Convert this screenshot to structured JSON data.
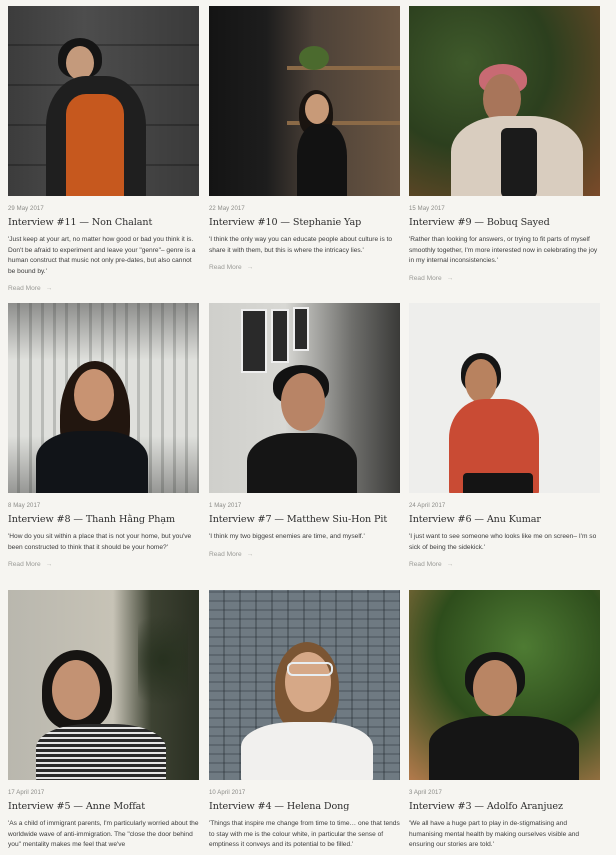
{
  "read_more_label": "Read More",
  "arrow": "→",
  "cards": [
    {
      "date": "29 May 2017",
      "title": "Interview #11 — Non Chalant",
      "excerpt": "'Just keep at your art, no matter how good or bad you think it is. Don't be afraid to experiment and leave your \"genre\"– genre is a human construct that music not only pre-dates, but also cannot be bound by.'"
    },
    {
      "date": "22 May 2017",
      "title": "Interview #10 — Stephanie Yap",
      "excerpt": "'I think the only way you can educate people about culture is to share it with them, but this is where the intricacy lies.'"
    },
    {
      "date": "15 May 2017",
      "title": "Interview #9 — Bobuq Sayed",
      "excerpt": "'Rather than looking for answers, or trying to fit parts of myself smoothly together, I'm more interested now in celebrating the joy in my internal inconsistencies.'"
    },
    {
      "date": "8 May 2017",
      "title": "Interview #8 — Thanh Hằng Phạm",
      "excerpt": "'How do you sit within a place that is not your home, but you've been constructed to think that it should be your home?'"
    },
    {
      "date": "1 May 2017",
      "title": "Interview #7 — Matthew Siu-Hon Pit",
      "excerpt": "'I think my two biggest enemies are time, and myself.'"
    },
    {
      "date": "24 April 2017",
      "title": "Interview #6 — Anu Kumar",
      "excerpt": "'I just want to see someone who looks like me on screen– I'm so sick of being the sidekick.'"
    },
    {
      "date": "17 April 2017",
      "title": "Interview #5 — Anne Moffat",
      "excerpt": "'As a child of immigrant parents, I'm particularly worried about the worldwide wave of anti-immigration. The \"close the door behind you\" mentality makes me feel that we've"
    },
    {
      "date": "10 April 2017",
      "title": "Interview #4 — Helena Dong",
      "excerpt": "'Things that inspire me change from time to time… one that tends to stay with me is the colour white, in particular the sense of emptiness it conveys and its potential to be filled.'"
    },
    {
      "date": "3 April 2017",
      "title": "Interview #3 — Adolfo Aranjuez",
      "excerpt": "'We all have a huge part to play in de-stigmatising and humanising mental health by making ourselves visible and ensuring our stories are told.'"
    }
  ]
}
